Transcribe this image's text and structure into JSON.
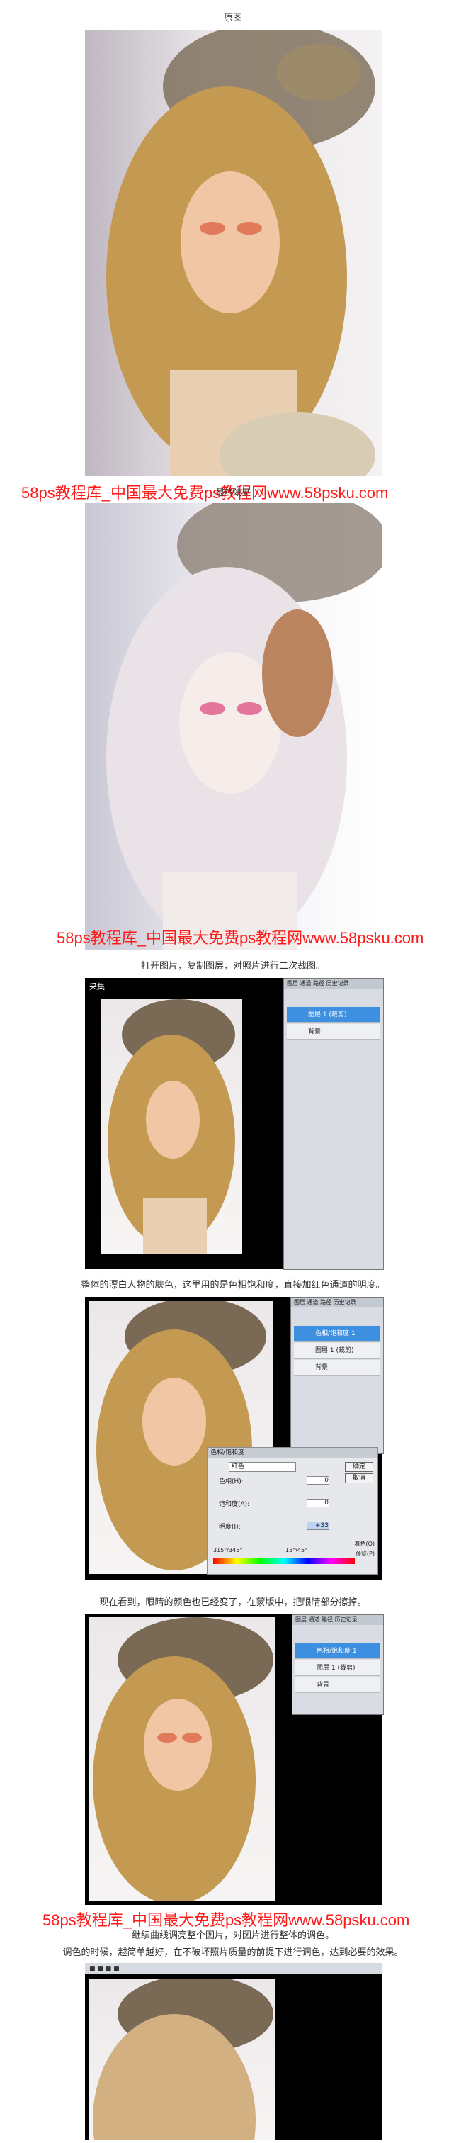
{
  "captions": {
    "original": "原图",
    "effect": "最终效果",
    "step1": "打开图片，复制图层，对照片进行二次裁图。",
    "step2": "整体的漂白人物的肤色，这里用的是色相饱和度，直接加红色通道的明度。",
    "step3": "现在看到，眼睛的颜色也已经变了，在蒙版中，把眼睛部分擦掉。",
    "step4a": "继续曲线调亮整个图片，对图片进行整体的调色。",
    "step4b": "调色的时候，越简单越好，在不破坏照片质量的前提下进行调色，达到必要的效果。"
  },
  "watermark": "58ps教程库_中国最大免费ps教程网www.58psku.com",
  "ps": {
    "collect_label": "采集",
    "layers": [
      "图层 1 (裁剪)",
      "背景",
      "色相/饱和度 1",
      "图层 1 (裁剪)",
      "背景"
    ],
    "hue_title": "色相/饱和度",
    "hue_channel": "红色",
    "hue_label": "色相(H):",
    "sat_label": "饱和度(A):",
    "light_label": "明度(I):",
    "hue_val": "0",
    "sat_val": "0",
    "light_val": "+33",
    "ok": "确定",
    "cancel": "取消",
    "range_left": "315°/345°",
    "range_right": "15°\\45°",
    "colorize": "着色(O)",
    "preview": "预览(P)"
  },
  "colors": {
    "watermark": "#ff1a1a",
    "selected_layer": "#3d8fe0"
  }
}
